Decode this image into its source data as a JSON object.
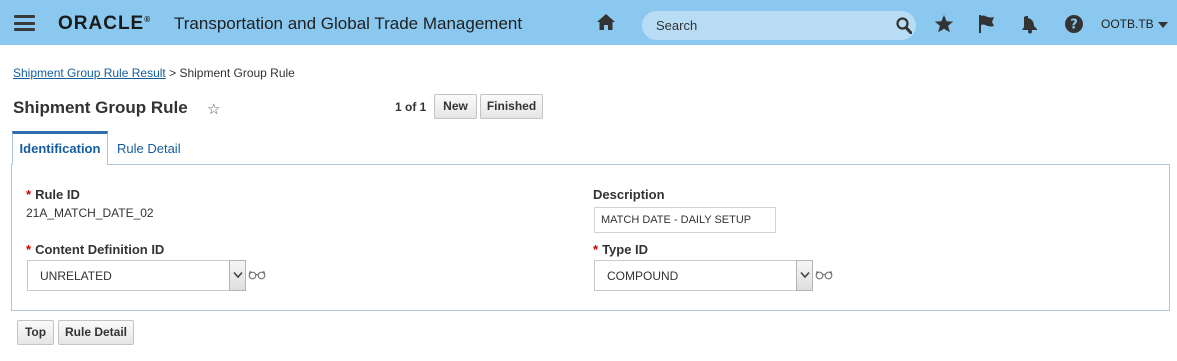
{
  "header": {
    "brand": "ORACLE",
    "brand_mark": "®",
    "app_title": "Transportation and Global Trade Management",
    "search_placeholder": "Search",
    "user": "OOTB.TB",
    "icons": [
      "menu-icon",
      "home-icon",
      "search-icon",
      "star-icon",
      "flag-icon",
      "bell-icon",
      "help-icon",
      "chevron-down-icon"
    ]
  },
  "breadcrumb": {
    "link": "Shipment Group Rule Result",
    "separator": ">",
    "current": "Shipment Group Rule"
  },
  "page": {
    "title": "Shipment Group Rule",
    "favorite_glyph": "☆",
    "pager": "1 of 1",
    "new_label": "New",
    "finished_label": "Finished"
  },
  "tabs": [
    {
      "label": "Identification",
      "active": true
    },
    {
      "label": "Rule Detail",
      "active": false
    }
  ],
  "form": {
    "required_marker": "*",
    "rule_id": {
      "label": "Rule ID",
      "value": "21A_MATCH_DATE_02"
    },
    "description": {
      "label": "Description",
      "value": "MATCH DATE  - DAILY SETUP"
    },
    "content_definition_id": {
      "label": "Content Definition ID",
      "value": "UNRELATED"
    },
    "type_id": {
      "label": "Type ID",
      "value": "COMPOUND"
    }
  },
  "footer": {
    "top_label": "Top",
    "rule_detail_label": "Rule Detail"
  },
  "colors": {
    "header_bg": "#8ac8f0",
    "link": "#145c9e",
    "tab_accent": "#2f6fb0",
    "required": "#cc0000"
  }
}
